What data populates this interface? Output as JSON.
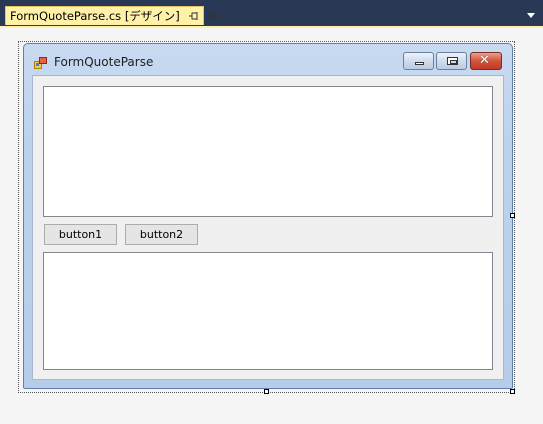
{
  "tab": {
    "label": "FormQuoteParse.cs [デザイン]",
    "pin_icon": "pin-icon",
    "close_icon": "close-icon"
  },
  "form": {
    "title": "FormQuoteParse",
    "icon": "form-icon",
    "caption_buttons": [
      "minimize-icon",
      "maximize-icon",
      "close-icon"
    ]
  },
  "buttons": {
    "button1": "button1",
    "button2": "button2"
  },
  "colors": {
    "chrome_bg": "#293955",
    "tab_bg": "#fff1a8",
    "designer_bg": "#f5f5f5",
    "form_caption": "#bcd2ec"
  }
}
